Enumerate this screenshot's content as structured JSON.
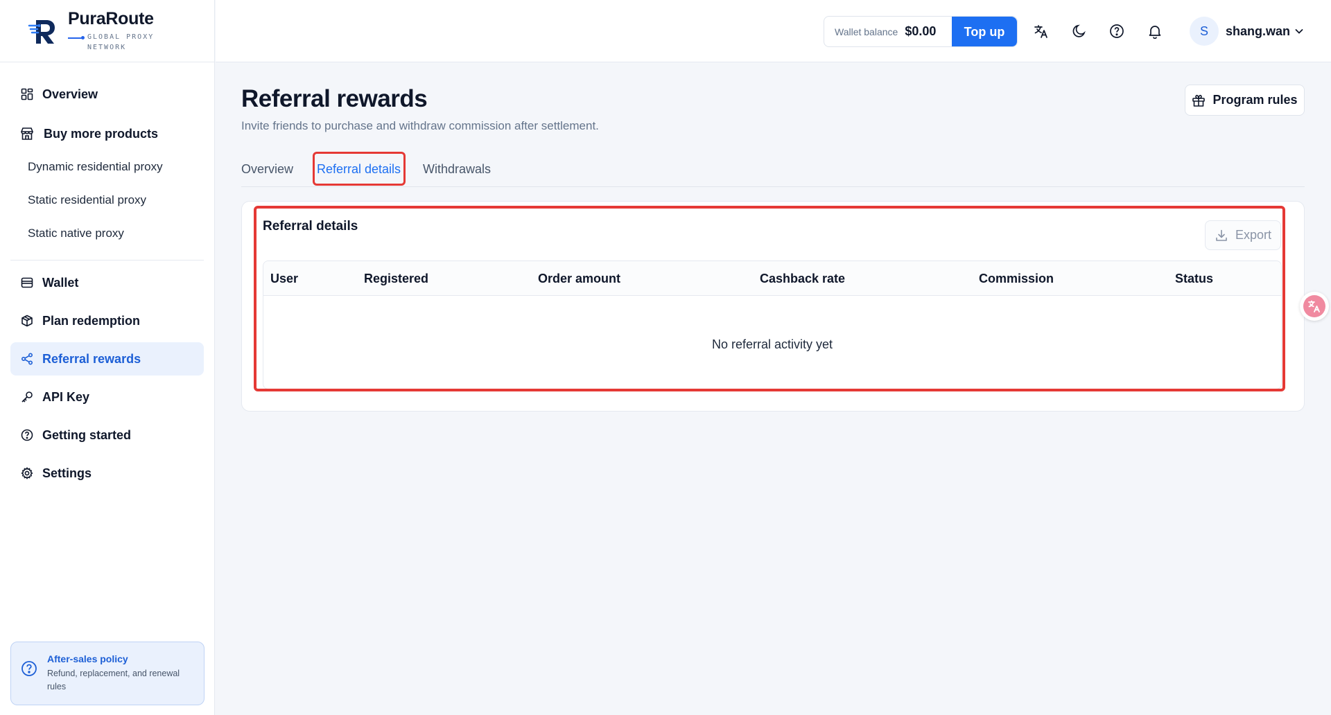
{
  "brand": {
    "name": "PuraRoute",
    "tagline": "GLOBAL PROXY NETWORK"
  },
  "sidebar": {
    "items": [
      {
        "label": "Overview",
        "icon": "grid-icon"
      },
      {
        "label": "Buy more products",
        "icon": "store-icon"
      },
      {
        "label": "Dynamic residential proxy"
      },
      {
        "label": "Static residential proxy"
      },
      {
        "label": "Static native proxy"
      },
      {
        "label": "Wallet",
        "icon": "wallet-icon"
      },
      {
        "label": "Plan redemption",
        "icon": "package-icon"
      },
      {
        "label": "Referral rewards",
        "icon": "share-icon",
        "active": true
      },
      {
        "label": "API Key",
        "icon": "key-icon"
      },
      {
        "label": "Getting started",
        "icon": "help-circle-icon"
      },
      {
        "label": "Settings",
        "icon": "gear-icon"
      }
    ],
    "policy": {
      "title": "After-sales policy",
      "description": "Refund, replacement, and renewal rules"
    }
  },
  "topbar": {
    "wallet_label": "Wallet balance",
    "wallet_amount": "$0.00",
    "topup_label": "Top up",
    "icons": [
      "translate-icon",
      "moon-icon",
      "help-icon",
      "bell-icon"
    ],
    "avatar_initial": "S",
    "username": "shang.wan"
  },
  "page": {
    "title": "Referral rewards",
    "subtitle": "Invite friends to purchase and withdraw commission after settlement.",
    "rules_label": "Program rules",
    "tabs": [
      {
        "label": "Overview"
      },
      {
        "label": "Referral details",
        "active": true
      },
      {
        "label": "Withdrawals"
      }
    ]
  },
  "card": {
    "title": "Referral details",
    "export_label": "Export",
    "columns": [
      "User",
      "Registered",
      "Order amount",
      "Cashback rate",
      "Commission",
      "Status"
    ],
    "empty_text": "No referral activity yet"
  },
  "colors": {
    "accent": "#1d6ff2",
    "highlight": "#e53935",
    "active_bg": "#eaf1fd"
  }
}
